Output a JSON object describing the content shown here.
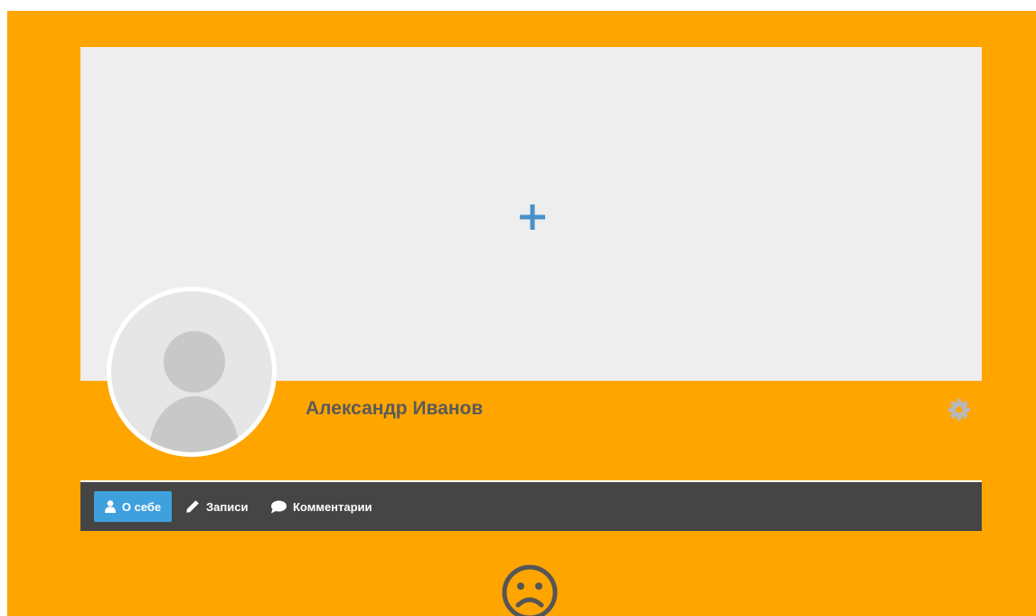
{
  "profile": {
    "name": "Александр Иванов"
  },
  "tabs": [
    {
      "label": "О себе",
      "icon": "user-icon",
      "active": true
    },
    {
      "label": "Записи",
      "icon": "pencil-icon",
      "active": false
    },
    {
      "label": "Комментарии",
      "icon": "comment-icon",
      "active": false
    }
  ],
  "icons": {
    "cover": "plus-icon",
    "settings": "gear-icon",
    "empty_state": "sad-face-icon"
  },
  "colors": {
    "background": "#ffa500",
    "cover": "#eeeeee",
    "accent": "#3fa0de",
    "tabs_bar": "#454545",
    "name_text": "#5a5a5a"
  }
}
